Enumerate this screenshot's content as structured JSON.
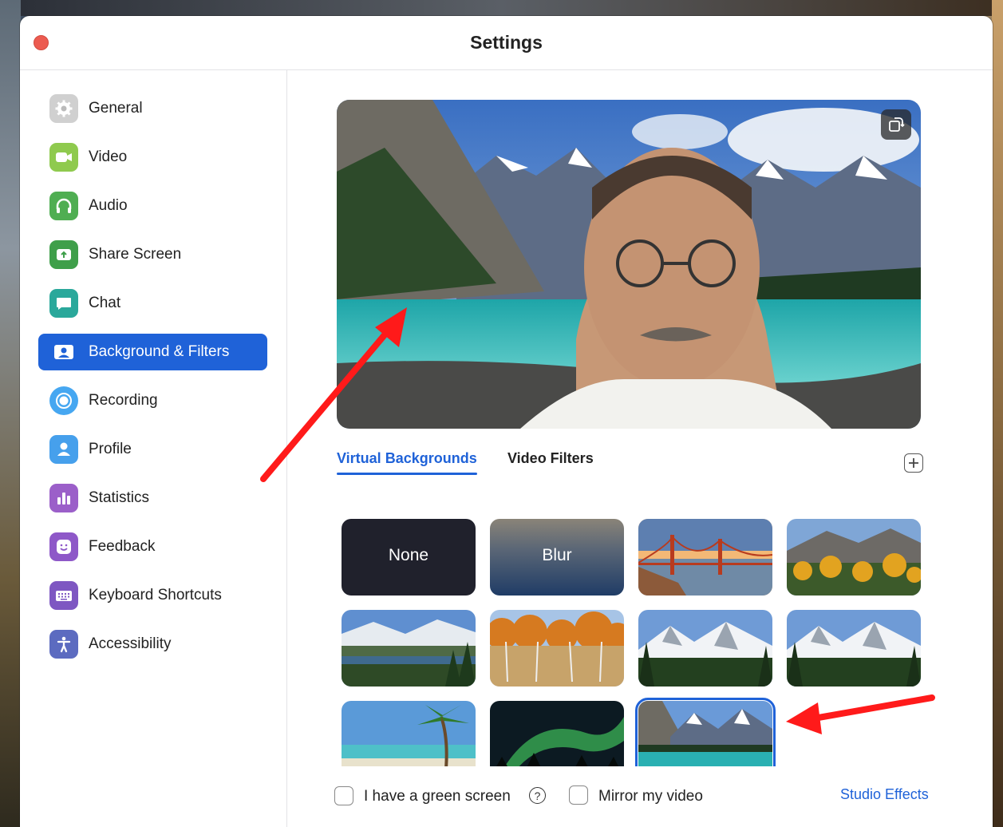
{
  "window": {
    "title": "Settings"
  },
  "sidebar": {
    "items": [
      {
        "label": "General",
        "icon": "gear-icon",
        "color": "#c8c8c8"
      },
      {
        "label": "Video",
        "icon": "video-camera-icon",
        "color": "#8bc34a"
      },
      {
        "label": "Audio",
        "icon": "headphones-icon",
        "color": "#4caf50"
      },
      {
        "label": "Share Screen",
        "icon": "share-screen-icon",
        "color": "#43a047"
      },
      {
        "label": "Chat",
        "icon": "chat-icon",
        "color": "#26a69a"
      },
      {
        "label": "Background & Filters",
        "icon": "background-icon",
        "color": "#1f62d8"
      },
      {
        "label": "Recording",
        "icon": "record-icon",
        "color": "#42a5f5"
      },
      {
        "label": "Profile",
        "icon": "profile-icon",
        "color": "#42a5f5"
      },
      {
        "label": "Statistics",
        "icon": "statistics-icon",
        "color": "#8e5cc7"
      },
      {
        "label": "Feedback",
        "icon": "feedback-icon",
        "color": "#8e5cc7"
      },
      {
        "label": "Keyboard Shortcuts",
        "icon": "keyboard-icon",
        "color": "#7e57c2"
      },
      {
        "label": "Accessibility",
        "icon": "accessibility-icon",
        "color": "#5c6bc0"
      }
    ],
    "active_index": 5
  },
  "tabs": [
    {
      "label": "Virtual Backgrounds",
      "active": true
    },
    {
      "label": "Video Filters",
      "active": false
    }
  ],
  "gallery": {
    "none_label": "None",
    "blur_label": "Blur",
    "selected": "mountain-lake"
  },
  "footer": {
    "green_screen_label": "I have a green screen",
    "mirror_label": "Mirror my video",
    "studio_effects_label": "Studio Effects"
  },
  "colors": {
    "accent": "#1f62d8",
    "close": "#ec5b50",
    "annotation_arrow": "#ff0000"
  }
}
